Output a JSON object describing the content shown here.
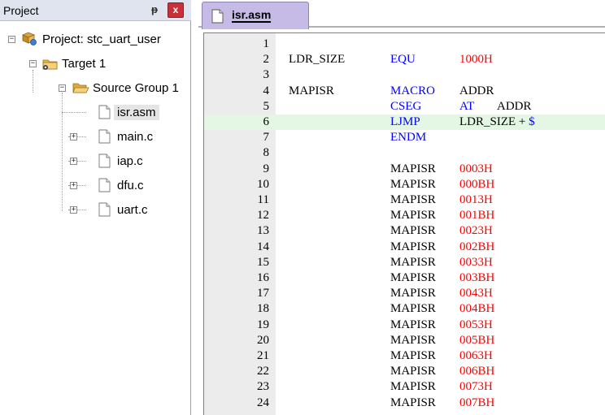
{
  "project_panel": {
    "title": "Project",
    "pin_glyph": "ᵽ",
    "close_glyph": "x",
    "tree": [
      {
        "label": "Project: stc_uart_user",
        "icon": "project-icon",
        "expander": "−"
      },
      {
        "label": "Target 1",
        "icon": "target-icon",
        "expander": "−"
      },
      {
        "label": "Source Group 1",
        "icon": "folder-open-icon",
        "expander": "−"
      },
      {
        "label": "isr.asm",
        "icon": "file-icon",
        "expander": ""
      },
      {
        "label": "main.c",
        "icon": "file-icon",
        "expander": "+"
      },
      {
        "label": "iap.c",
        "icon": "file-icon",
        "expander": "+"
      },
      {
        "label": "dfu.c",
        "icon": "file-icon",
        "expander": "+"
      },
      {
        "label": "uart.c",
        "icon": "file-icon",
        "expander": "+"
      }
    ]
  },
  "editor": {
    "tab": {
      "label": "isr.asm",
      "icon": "file-icon"
    },
    "lines": [
      {
        "n": "1",
        "label": "",
        "op": "",
        "arg": "",
        "arg_kind": "",
        "extra": ""
      },
      {
        "n": "2",
        "label": "LDR_SIZE",
        "op": "EQU",
        "arg": "1000H",
        "arg_kind": "num",
        "extra": ""
      },
      {
        "n": "3",
        "label": "",
        "op": "",
        "arg": "",
        "arg_kind": "",
        "extra": ""
      },
      {
        "n": "4",
        "label": "MAPISR",
        "op": "MACRO",
        "arg": "ADDR",
        "arg_kind": "ident",
        "extra": ""
      },
      {
        "n": "5",
        "label": "",
        "op": "CSEG",
        "arg": "AT",
        "arg_kind": "kw",
        "extra": "ADDR"
      },
      {
        "n": "6",
        "label": "",
        "op": "LJMP",
        "arg": "LDR_SIZE + ",
        "arg_kind": "ident",
        "extra": "$"
      },
      {
        "n": "7",
        "label": "",
        "op": "ENDM",
        "arg": "",
        "arg_kind": "",
        "extra": ""
      },
      {
        "n": "8",
        "label": "",
        "op": "",
        "arg": "",
        "arg_kind": "",
        "extra": ""
      },
      {
        "n": "9",
        "label": "",
        "op": "MAPISR",
        "arg": "0003H",
        "arg_kind": "num",
        "extra": ""
      },
      {
        "n": "10",
        "label": "",
        "op": "MAPISR",
        "arg": "000BH",
        "arg_kind": "num",
        "extra": ""
      },
      {
        "n": "11",
        "label": "",
        "op": "MAPISR",
        "arg": "0013H",
        "arg_kind": "num",
        "extra": ""
      },
      {
        "n": "12",
        "label": "",
        "op": "MAPISR",
        "arg": "001BH",
        "arg_kind": "num",
        "extra": ""
      },
      {
        "n": "13",
        "label": "",
        "op": "MAPISR",
        "arg": "0023H",
        "arg_kind": "num",
        "extra": ""
      },
      {
        "n": "14",
        "label": "",
        "op": "MAPISR",
        "arg": "002BH",
        "arg_kind": "num",
        "extra": ""
      },
      {
        "n": "15",
        "label": "",
        "op": "MAPISR",
        "arg": "0033H",
        "arg_kind": "num",
        "extra": ""
      },
      {
        "n": "16",
        "label": "",
        "op": "MAPISR",
        "arg": "003BH",
        "arg_kind": "num",
        "extra": ""
      },
      {
        "n": "17",
        "label": "",
        "op": "MAPISR",
        "arg": "0043H",
        "arg_kind": "num",
        "extra": ""
      },
      {
        "n": "18",
        "label": "",
        "op": "MAPISR",
        "arg": "004BH",
        "arg_kind": "num",
        "extra": ""
      },
      {
        "n": "19",
        "label": "",
        "op": "MAPISR",
        "arg": "0053H",
        "arg_kind": "num",
        "extra": ""
      },
      {
        "n": "20",
        "label": "",
        "op": "MAPISR",
        "arg": "005BH",
        "arg_kind": "num",
        "extra": ""
      },
      {
        "n": "21",
        "label": "",
        "op": "MAPISR",
        "arg": "0063H",
        "arg_kind": "num",
        "extra": ""
      },
      {
        "n": "22",
        "label": "",
        "op": "MAPISR",
        "arg": "006BH",
        "arg_kind": "num",
        "extra": ""
      },
      {
        "n": "23",
        "label": "",
        "op": "MAPISR",
        "arg": "0073H",
        "arg_kind": "num",
        "extra": ""
      },
      {
        "n": "24",
        "label": "",
        "op": "MAPISR",
        "arg": "007BH",
        "arg_kind": "num",
        "extra": ""
      }
    ],
    "highlighted_line": "6"
  },
  "colors": {
    "keyword": "#0000ff",
    "number": "#ff0000",
    "tab_active": "#c5bbe6",
    "line_highlight": "#e4f7e4",
    "panel_header": "#dfe4ee",
    "close_button": "#c8313a"
  }
}
